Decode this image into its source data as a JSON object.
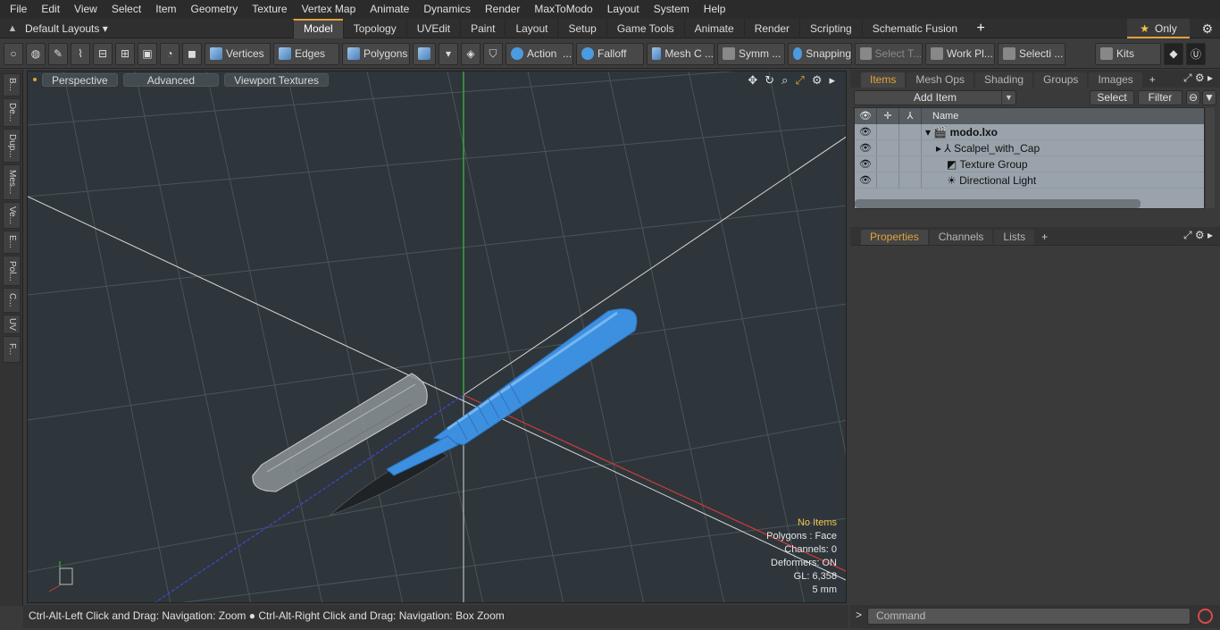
{
  "menu": [
    "File",
    "Edit",
    "View",
    "Select",
    "Item",
    "Geometry",
    "Texture",
    "Vertex Map",
    "Animate",
    "Dynamics",
    "Render",
    "MaxToModo",
    "Layout",
    "System",
    "Help"
  ],
  "layout": {
    "selector": "Default Layouts ▾",
    "tabs": [
      "Model",
      "Topology",
      "UVEdit",
      "Paint",
      "Layout",
      "Setup",
      "Game Tools",
      "Animate",
      "Render",
      "Scripting",
      "Schematic Fusion"
    ],
    "active_tab": "Model",
    "only_label": "Only"
  },
  "toolbar": {
    "vertices": "Vertices",
    "edges": "Edges",
    "polygons": "Polygons",
    "action": "Action",
    "falloff": "Falloff",
    "mesh": "Mesh C ...",
    "symm": "Symm ...",
    "snapping": "Snapping",
    "select_t": "Select T...",
    "workpl": "Work Pl...",
    "selecti": "Selecti ...",
    "kits": "Kits"
  },
  "left_tabs": [
    "B...",
    "De...",
    "Dup...",
    "Mes...",
    "Ve...",
    "E...",
    "Pol...",
    "C...",
    "UV",
    "F..."
  ],
  "viewport": {
    "buttons": [
      "Perspective",
      "Advanced",
      "Viewport Textures"
    ],
    "info": {
      "no_items": "No Items",
      "polygons": "Polygons : Face",
      "channels": "Channels: 0",
      "deformers": "Deformers: ON",
      "gl": "GL: 6,358",
      "unit": "5 mm"
    }
  },
  "statusbar": "Ctrl-Alt-Left Click and Drag: Navigation: Zoom ● Ctrl-Alt-Right Click and Drag: Navigation: Box Zoom",
  "items_panel": {
    "tabs": [
      "Items",
      "Mesh Ops",
      "Shading",
      "Groups",
      "Images"
    ],
    "add_item": "Add Item",
    "select": "Select",
    "filter": "Filter",
    "name_header": "Name",
    "rows": [
      {
        "label": "modo.lxo"
      },
      {
        "label": "Scalpel_with_Cap"
      },
      {
        "label": "Texture Group"
      },
      {
        "label": "Directional Light"
      }
    ]
  },
  "props_panel": {
    "tabs": [
      "Properties",
      "Channels",
      "Lists"
    ]
  },
  "command": {
    "prompt": ">",
    "placeholder": "Command"
  },
  "colors": {
    "accent": "#e2a23b",
    "scalpel": "#3d8fe0",
    "axis_x": "#d43a3a",
    "axis_y": "#3cc23c",
    "axis_z": "#3a4ad4"
  }
}
